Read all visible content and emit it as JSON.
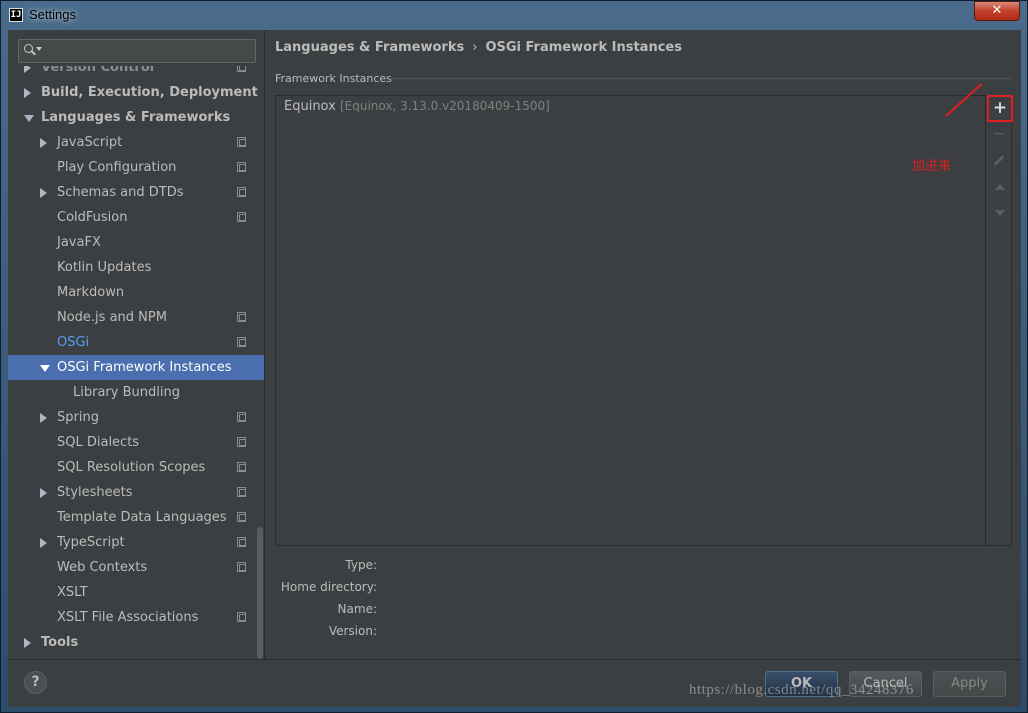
{
  "window": {
    "title": "Settings",
    "close_symbol": "✕"
  },
  "search": {
    "placeholder": "",
    "value": ""
  },
  "tree": [
    {
      "label": "Version Control",
      "level": 0,
      "arrow": "right",
      "bold": true,
      "state": "cut",
      "project": true
    },
    {
      "label": "Build, Execution, Deployment",
      "level": 0,
      "arrow": "right",
      "bold": true
    },
    {
      "label": "Languages & Frameworks",
      "level": 0,
      "arrow": "down",
      "bold": true
    },
    {
      "label": "JavaScript",
      "level": 1,
      "arrow": "right",
      "project": true
    },
    {
      "label": "Play Configuration",
      "level": 1,
      "project": true
    },
    {
      "label": "Schemas and DTDs",
      "level": 1,
      "arrow": "right",
      "project": true
    },
    {
      "label": "ColdFusion",
      "level": 1,
      "project": true
    },
    {
      "label": "JavaFX",
      "level": 1
    },
    {
      "label": "Kotlin Updates",
      "level": 1
    },
    {
      "label": "Markdown",
      "level": 1
    },
    {
      "label": "Node.js and NPM",
      "level": 1,
      "project": true
    },
    {
      "label": "OSGi",
      "level": 1,
      "state": "link",
      "project": true
    },
    {
      "label": "OSGi Framework Instances",
      "level": 1,
      "arrow": "down",
      "state": "selected"
    },
    {
      "label": "Library Bundling",
      "level": 2
    },
    {
      "label": "Spring",
      "level": 1,
      "arrow": "right",
      "project": true
    },
    {
      "label": "SQL Dialects",
      "level": 1,
      "project": true
    },
    {
      "label": "SQL Resolution Scopes",
      "level": 1,
      "project": true
    },
    {
      "label": "Stylesheets",
      "level": 1,
      "arrow": "right",
      "project": true
    },
    {
      "label": "Template Data Languages",
      "level": 1,
      "project": true
    },
    {
      "label": "TypeScript",
      "level": 1,
      "arrow": "right",
      "project": true
    },
    {
      "label": "Web Contexts",
      "level": 1,
      "project": true
    },
    {
      "label": "XSLT",
      "level": 1
    },
    {
      "label": "XSLT File Associations",
      "level": 1,
      "project": true
    },
    {
      "label": "Tools",
      "level": 0,
      "arrow": "right",
      "bold": true
    }
  ],
  "breadcrumb": {
    "parent": "Languages & Frameworks",
    "separator": "›",
    "current": "OSGi Framework Instances"
  },
  "framework_section": {
    "label": "Framework Instances",
    "instances": [
      {
        "name": "Equinox",
        "detail": "[Equinox, 3.13.0.v20180409-1500]"
      }
    ],
    "toolbar": {
      "add": "+",
      "remove": "−"
    }
  },
  "annotation": {
    "text": "加进来",
    "color": "#e02020"
  },
  "properties": {
    "type": "Type:",
    "home": "Home directory:",
    "name": "Name:",
    "version": "Version:"
  },
  "buttons": {
    "help": "?",
    "ok": "OK",
    "cancel": "Cancel",
    "apply": "Apply"
  },
  "watermark": "https://blog.csdn.net/qq_34248376",
  "colors": {
    "selection": "#4b6eaf",
    "link": "#589df6",
    "background": "#3c3f41",
    "annotation": "#e02020"
  }
}
